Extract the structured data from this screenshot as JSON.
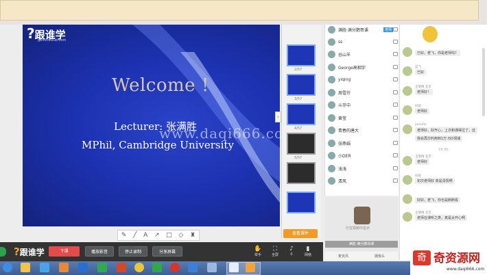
{
  "slide": {
    "logo_text": "跟谁学",
    "logo_url": "genshuixue.com",
    "title": "Welcome !",
    "lecturer": "Lecturer: 张满胜",
    "affiliation": "MPhil, Cambridge University"
  },
  "watermark": "www.daqi666.com",
  "annotation_tools": [
    "pencil-icon",
    "line-icon",
    "text-icon",
    "arrow-icon",
    "rectangle-icon",
    "eraser-icon",
    "trash-icon"
  ],
  "thumbnails": {
    "labels": [
      "2/57",
      "3/57",
      "4/57",
      "5/57"
    ],
    "button": "查看课件"
  },
  "participants": [
    {
      "name": "满胜·满分鹦哥课",
      "tag": "老师"
    },
    {
      "name": "ss"
    },
    {
      "name": "谷山羊"
    },
    {
      "name": "George高相宇"
    },
    {
      "name": "yiqing"
    },
    {
      "name": "周雪芬"
    },
    {
      "name": "斗牙中"
    },
    {
      "name": "黄莹"
    },
    {
      "name": "青春的唐大"
    },
    {
      "name": "张燕娟"
    },
    {
      "name": "小DER"
    },
    {
      "name": "浅浅"
    },
    {
      "name": "清风"
    }
  ],
  "camera": {
    "caption": "已在视频中显示",
    "name": "满胜·满分鹦哥课",
    "tools": [
      "麦克风",
      "摄像头"
    ]
  },
  "chat": [
    {
      "name": "",
      "text": "已好，老飞，你是老师吗？"
    },
    {
      "name": "蓝飞",
      "text": "已好"
    },
    {
      "name": "王明倩 北京",
      "text": "老师好！"
    },
    {
      "name": "同班",
      "text": "老师好"
    },
    {
      "name": "jennifer",
      "text": "老师好，好开心，上次和课得过了，还"
    },
    {
      "name": "",
      "text": "我会再次利用到1万 ISO领域"
    },
    {
      "name": "王明倩 北京",
      "text": "老师好"
    },
    {
      "name": "同班",
      "text": "初次老师好 真是清情啊"
    },
    {
      "name": "",
      "text": "好好，老飞，你也是刷刷看"
    },
    {
      "name": "王明倩 北京",
      "text": "老师在课听之类，真是太开心啊"
    }
  ],
  "chat_time": "19:35",
  "control_bar": {
    "logo": "跟谁学",
    "end_button": "下课",
    "buttons": [
      "播放影音",
      "停止录制",
      "分享屏幕"
    ],
    "icons": [
      {
        "icon": "hand-icon",
        "label": "举手"
      },
      {
        "icon": "fullscreen-icon",
        "label": "全屏"
      },
      {
        "icon": "volume-icon",
        "label": "0"
      },
      {
        "icon": "signal-icon",
        "label": "网络"
      }
    ]
  },
  "brand": {
    "name": "奇资源网",
    "url": "www.daqi666.com"
  },
  "colors": {
    "slide_bg": "#1d32b2",
    "end_button": "#e44b4b",
    "brand_red": "#c8201c",
    "accent_orange": "#f29a26"
  }
}
